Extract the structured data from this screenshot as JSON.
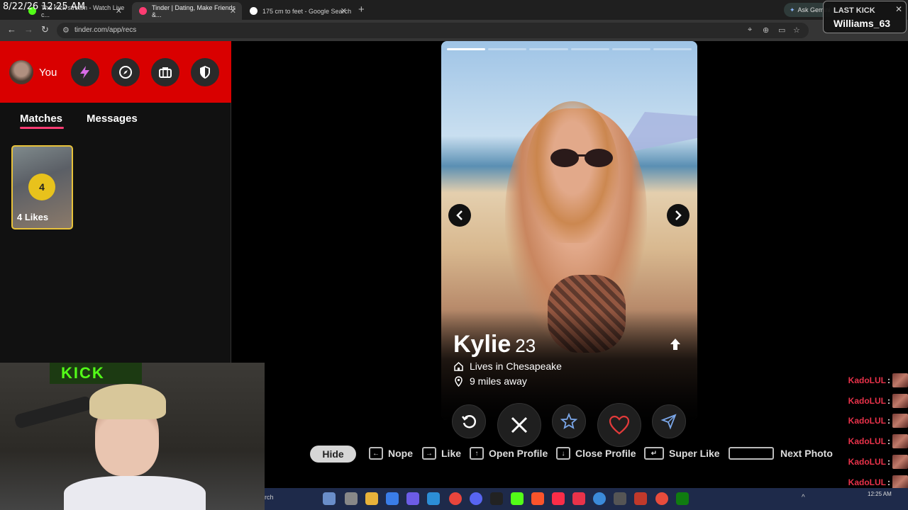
{
  "overlay": {
    "timestamp": "8/22/26 12:25 AM"
  },
  "browser": {
    "tabs": [
      {
        "label": "The Kick stream - Watch Live c..."
      },
      {
        "label": "Tinder | Dating, Make Friends &..."
      },
      {
        "label": "175 cm to feet - Google Search"
      }
    ],
    "url": "tinder.com/app/recs",
    "gemini_label": "Ask Gemini"
  },
  "last_kick": {
    "title": "LAST KICK",
    "user": "Williams_63"
  },
  "sidebar": {
    "you_label": "You",
    "tabs": {
      "matches": "Matches",
      "messages": "Messages"
    },
    "likes": {
      "count": "4",
      "label": "4 Likes"
    }
  },
  "webcam": {
    "banner": "KICK"
  },
  "profile": {
    "name": "Kylie",
    "age": "23",
    "lives": "Lives in Chesapeake",
    "distance": "9 miles away",
    "photo_count": 6,
    "photo_index": 0
  },
  "shortcuts": {
    "hide": "Hide",
    "nope": "Nope",
    "like": "Like",
    "open_profile": "Open Profile",
    "close_profile": "Close Profile",
    "super_like": "Super Like",
    "next_photo": "Next Photo"
  },
  "chat": {
    "messages": [
      {
        "user": "KadoLUL"
      },
      {
        "user": "KadoLUL"
      },
      {
        "user": "KadoLUL"
      },
      {
        "user": "KadoLUL"
      },
      {
        "user": "KadoLUL"
      },
      {
        "user": "KadoLUL"
      },
      {
        "user": "KadoLUL"
      }
    ]
  },
  "taskbar": {
    "search_stub": "rch",
    "time": "12:25 AM"
  },
  "colors": {
    "tinder_red": "#d90000",
    "nope": "#ffffff",
    "like": "#e23a3a",
    "badge": "#e8c21c",
    "chat_name": "#e9324a"
  }
}
